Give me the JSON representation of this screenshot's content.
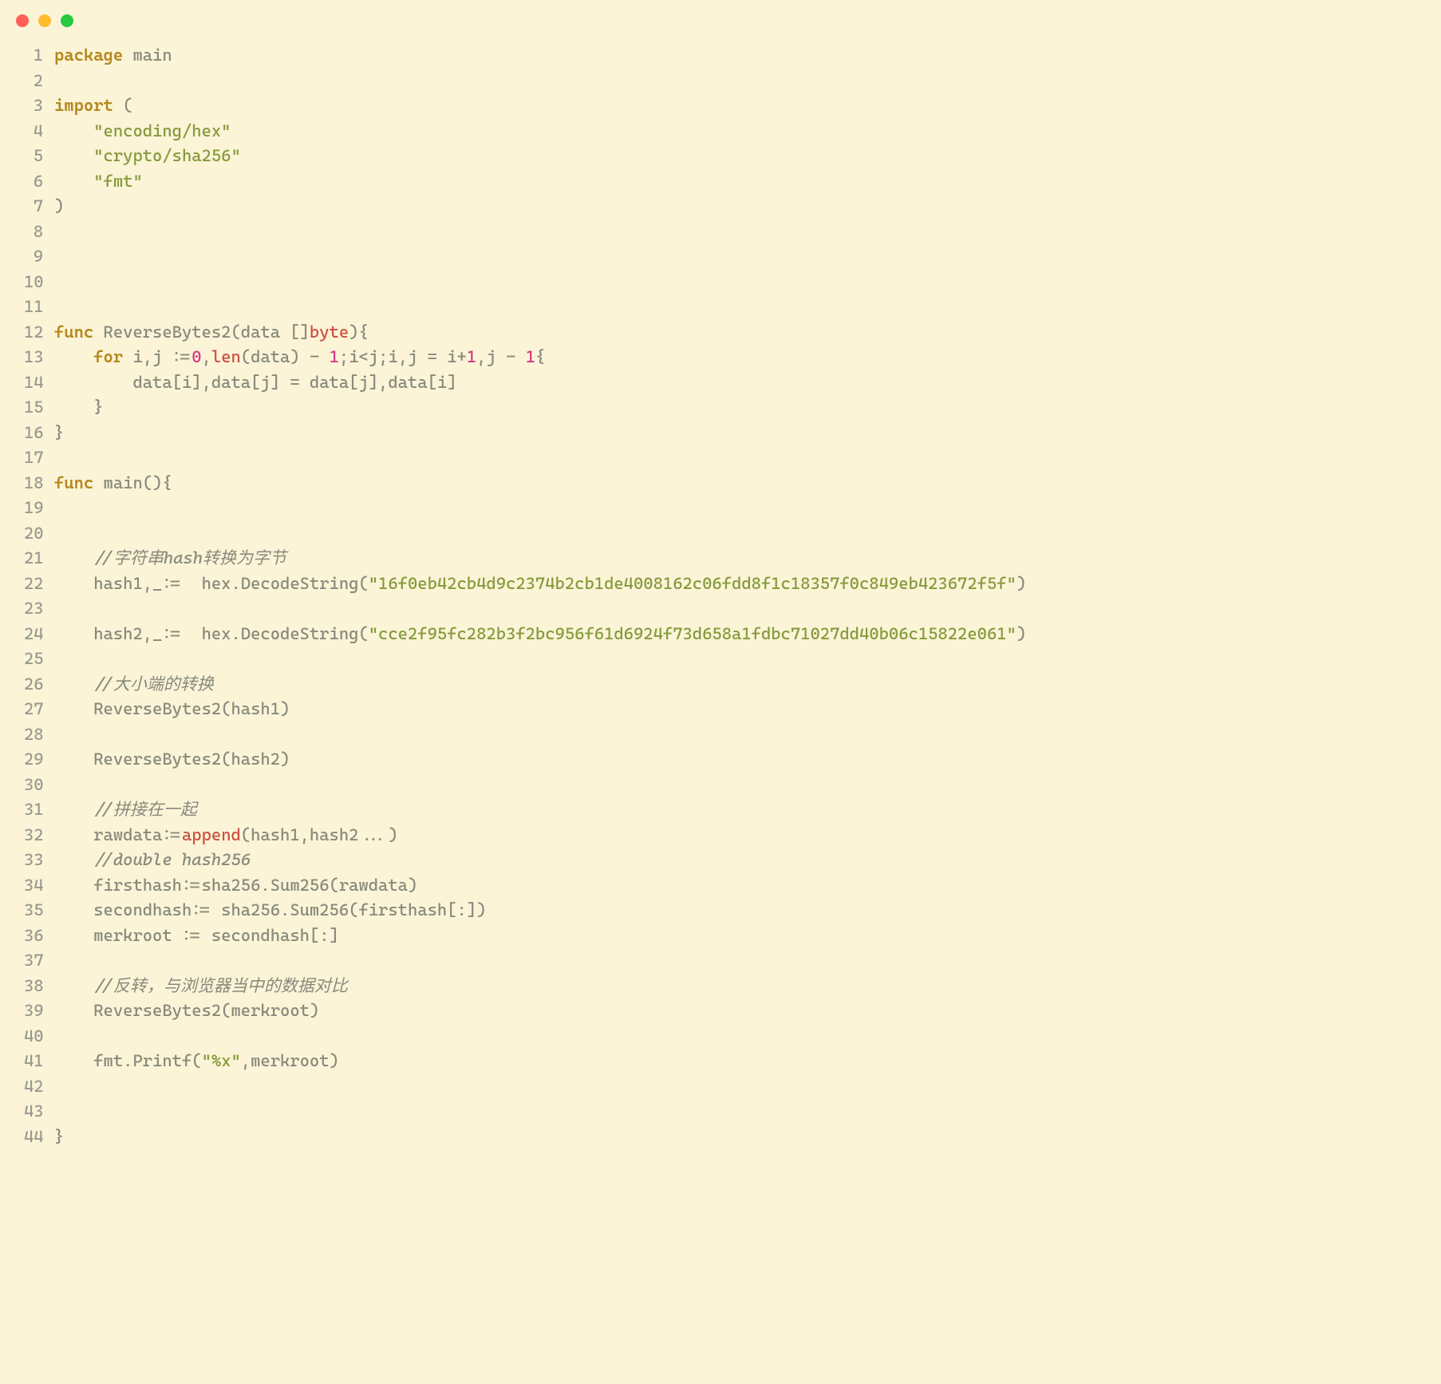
{
  "lines": [
    {
      "num": "1",
      "segments": [
        {
          "cls": "kw",
          "text": "package"
        },
        {
          "cls": "ident",
          "text": " main"
        }
      ]
    },
    {
      "num": "2",
      "segments": []
    },
    {
      "num": "3",
      "segments": [
        {
          "cls": "kw",
          "text": "import"
        },
        {
          "cls": "punct",
          "text": " ("
        }
      ]
    },
    {
      "num": "4",
      "segments": [
        {
          "cls": "punct",
          "text": "    "
        },
        {
          "cls": "str",
          "text": "\"encoding/hex\""
        }
      ]
    },
    {
      "num": "5",
      "segments": [
        {
          "cls": "punct",
          "text": "    "
        },
        {
          "cls": "str",
          "text": "\"crypto/sha256\""
        }
      ]
    },
    {
      "num": "6",
      "segments": [
        {
          "cls": "punct",
          "text": "    "
        },
        {
          "cls": "str",
          "text": "\"fmt\""
        }
      ]
    },
    {
      "num": "7",
      "segments": [
        {
          "cls": "punct",
          "text": ")"
        }
      ]
    },
    {
      "num": "8",
      "segments": []
    },
    {
      "num": "9",
      "segments": []
    },
    {
      "num": "10",
      "segments": []
    },
    {
      "num": "11",
      "segments": []
    },
    {
      "num": "12",
      "segments": [
        {
          "cls": "kw",
          "text": "func"
        },
        {
          "cls": "ident",
          "text": " ReverseBytes2(data []"
        },
        {
          "cls": "type",
          "text": "byte"
        },
        {
          "cls": "punct",
          "text": "){"
        }
      ]
    },
    {
      "num": "13",
      "segments": [
        {
          "cls": "punct",
          "text": "    "
        },
        {
          "cls": "kw",
          "text": "for"
        },
        {
          "cls": "ident",
          "text": " i,j :="
        },
        {
          "cls": "num",
          "text": "0"
        },
        {
          "cls": "punct",
          "text": ","
        },
        {
          "cls": "builtin",
          "text": "len"
        },
        {
          "cls": "ident",
          "text": "(data) - "
        },
        {
          "cls": "num",
          "text": "1"
        },
        {
          "cls": "ident",
          "text": ";i<j;i,j = i+"
        },
        {
          "cls": "num",
          "text": "1"
        },
        {
          "cls": "ident",
          "text": ",j - "
        },
        {
          "cls": "num",
          "text": "1"
        },
        {
          "cls": "punct",
          "text": "{"
        }
      ]
    },
    {
      "num": "14",
      "segments": [
        {
          "cls": "ident",
          "text": "        data[i],data[j] = data[j],data[i]"
        }
      ]
    },
    {
      "num": "15",
      "segments": [
        {
          "cls": "punct",
          "text": "    }"
        }
      ]
    },
    {
      "num": "16",
      "segments": [
        {
          "cls": "punct",
          "text": "}"
        }
      ]
    },
    {
      "num": "17",
      "segments": []
    },
    {
      "num": "18",
      "segments": [
        {
          "cls": "kw",
          "text": "func"
        },
        {
          "cls": "ident",
          "text": " main(){"
        }
      ]
    },
    {
      "num": "19",
      "segments": []
    },
    {
      "num": "20",
      "segments": []
    },
    {
      "num": "21",
      "segments": [
        {
          "cls": "punct",
          "text": "    "
        },
        {
          "cls": "comment",
          "text": "//字符串hash转换为字节"
        }
      ]
    },
    {
      "num": "22",
      "segments": [
        {
          "cls": "ident",
          "text": "    hash1,_:=  hex.DecodeString("
        },
        {
          "cls": "str",
          "text": "\"16f0eb42cb4d9c2374b2cb1de4008162c06fdd8f1c18357f0c849eb423672f5f\""
        },
        {
          "cls": "punct",
          "text": ")"
        }
      ]
    },
    {
      "num": "23",
      "segments": []
    },
    {
      "num": "24",
      "segments": [
        {
          "cls": "ident",
          "text": "    hash2,_:=  hex.DecodeString("
        },
        {
          "cls": "str",
          "text": "\"cce2f95fc282b3f2bc956f61d6924f73d658a1fdbc71027dd40b06c15822e061\""
        },
        {
          "cls": "punct",
          "text": ")"
        }
      ]
    },
    {
      "num": "25",
      "segments": []
    },
    {
      "num": "26",
      "segments": [
        {
          "cls": "punct",
          "text": "    "
        },
        {
          "cls": "comment",
          "text": "//大小端的转换"
        }
      ]
    },
    {
      "num": "27",
      "segments": [
        {
          "cls": "ident",
          "text": "    ReverseBytes2(hash1)"
        }
      ]
    },
    {
      "num": "28",
      "segments": []
    },
    {
      "num": "29",
      "segments": [
        {
          "cls": "ident",
          "text": "    ReverseBytes2(hash2)"
        }
      ]
    },
    {
      "num": "30",
      "segments": []
    },
    {
      "num": "31",
      "segments": [
        {
          "cls": "punct",
          "text": "    "
        },
        {
          "cls": "comment",
          "text": "//拼接在一起"
        }
      ]
    },
    {
      "num": "32",
      "segments": [
        {
          "cls": "ident",
          "text": "    rawdata:="
        },
        {
          "cls": "builtin",
          "text": "append"
        },
        {
          "cls": "ident",
          "text": "(hash1,hash2...)"
        }
      ]
    },
    {
      "num": "33",
      "segments": [
        {
          "cls": "punct",
          "text": "    "
        },
        {
          "cls": "comment",
          "text": "//double hash256"
        }
      ]
    },
    {
      "num": "34",
      "segments": [
        {
          "cls": "ident",
          "text": "    firsthash:=sha256.Sum256(rawdata)"
        }
      ]
    },
    {
      "num": "35",
      "segments": [
        {
          "cls": "ident",
          "text": "    secondhash:= sha256.Sum256(firsthash[:])"
        }
      ]
    },
    {
      "num": "36",
      "segments": [
        {
          "cls": "ident",
          "text": "    merkroot := secondhash[:]"
        }
      ]
    },
    {
      "num": "37",
      "segments": []
    },
    {
      "num": "38",
      "segments": [
        {
          "cls": "punct",
          "text": "    "
        },
        {
          "cls": "comment",
          "text": "//反转，与浏览器当中的数据对比"
        }
      ]
    },
    {
      "num": "39",
      "segments": [
        {
          "cls": "ident",
          "text": "    ReverseBytes2(merkroot)"
        }
      ]
    },
    {
      "num": "40",
      "segments": []
    },
    {
      "num": "41",
      "segments": [
        {
          "cls": "ident",
          "text": "    fmt.Printf("
        },
        {
          "cls": "str",
          "text": "\"%x\""
        },
        {
          "cls": "ident",
          "text": ",merkroot)"
        }
      ]
    },
    {
      "num": "42",
      "segments": []
    },
    {
      "num": "43",
      "segments": []
    },
    {
      "num": "44",
      "segments": [
        {
          "cls": "punct",
          "text": "}"
        }
      ]
    }
  ]
}
